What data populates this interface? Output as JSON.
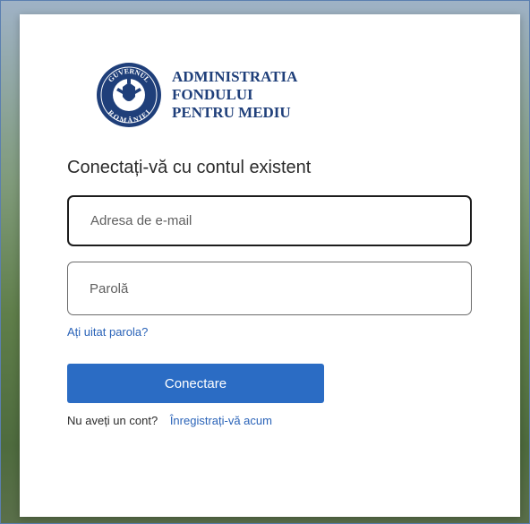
{
  "brand": {
    "seal_text_top": "GUVERNUL",
    "seal_text_bottom": "ROMÂNIEI",
    "org_line1": "ADMINISTRATIA",
    "org_line2": "FONDULUI",
    "org_line3": "PENTRU MEDIU",
    "color": "#1f3f7a"
  },
  "form": {
    "heading": "Conectați-vă cu contul existent",
    "email_placeholder": "Adresa de e-mail",
    "password_placeholder": "Parolă",
    "forgot_label": "Ați uitat parola?",
    "submit_label": "Conectare",
    "no_account_text": "Nu aveți un cont?",
    "register_label": "Înregistrați-vă acum",
    "accent": "#2b6cc4"
  }
}
